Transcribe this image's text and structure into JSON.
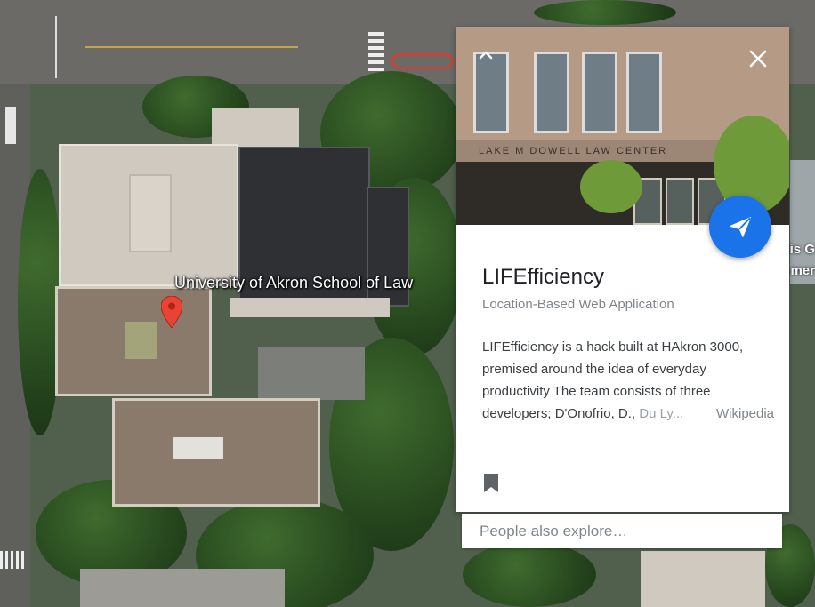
{
  "map": {
    "place_label": "University of Akron School of Law",
    "edge_text_1": "is G",
    "edge_text_2": "mer"
  },
  "card": {
    "photo_sign": "LAKE M DOWELL LAW CENTER",
    "title": "LIFEfficiency",
    "subtitle": "Location-Based Web Application",
    "description": "LIFEfficiency is a hack built at HAkron 3000, premised around the idea of everyday productivity The team consists of three",
    "description_last": "developers; D'Onofrio, D., ",
    "description_fade": "Du Ly...",
    "source_link": "Wikipedia"
  },
  "explore": {
    "placeholder": "People also explore…"
  },
  "colors": {
    "accent": "#1a73e8",
    "pin": "#ea4335"
  },
  "icons": {
    "collapse": "chevron-up-icon",
    "close": "close-icon",
    "share": "send-icon",
    "save": "bookmark-icon",
    "pin": "map-pin-icon"
  }
}
